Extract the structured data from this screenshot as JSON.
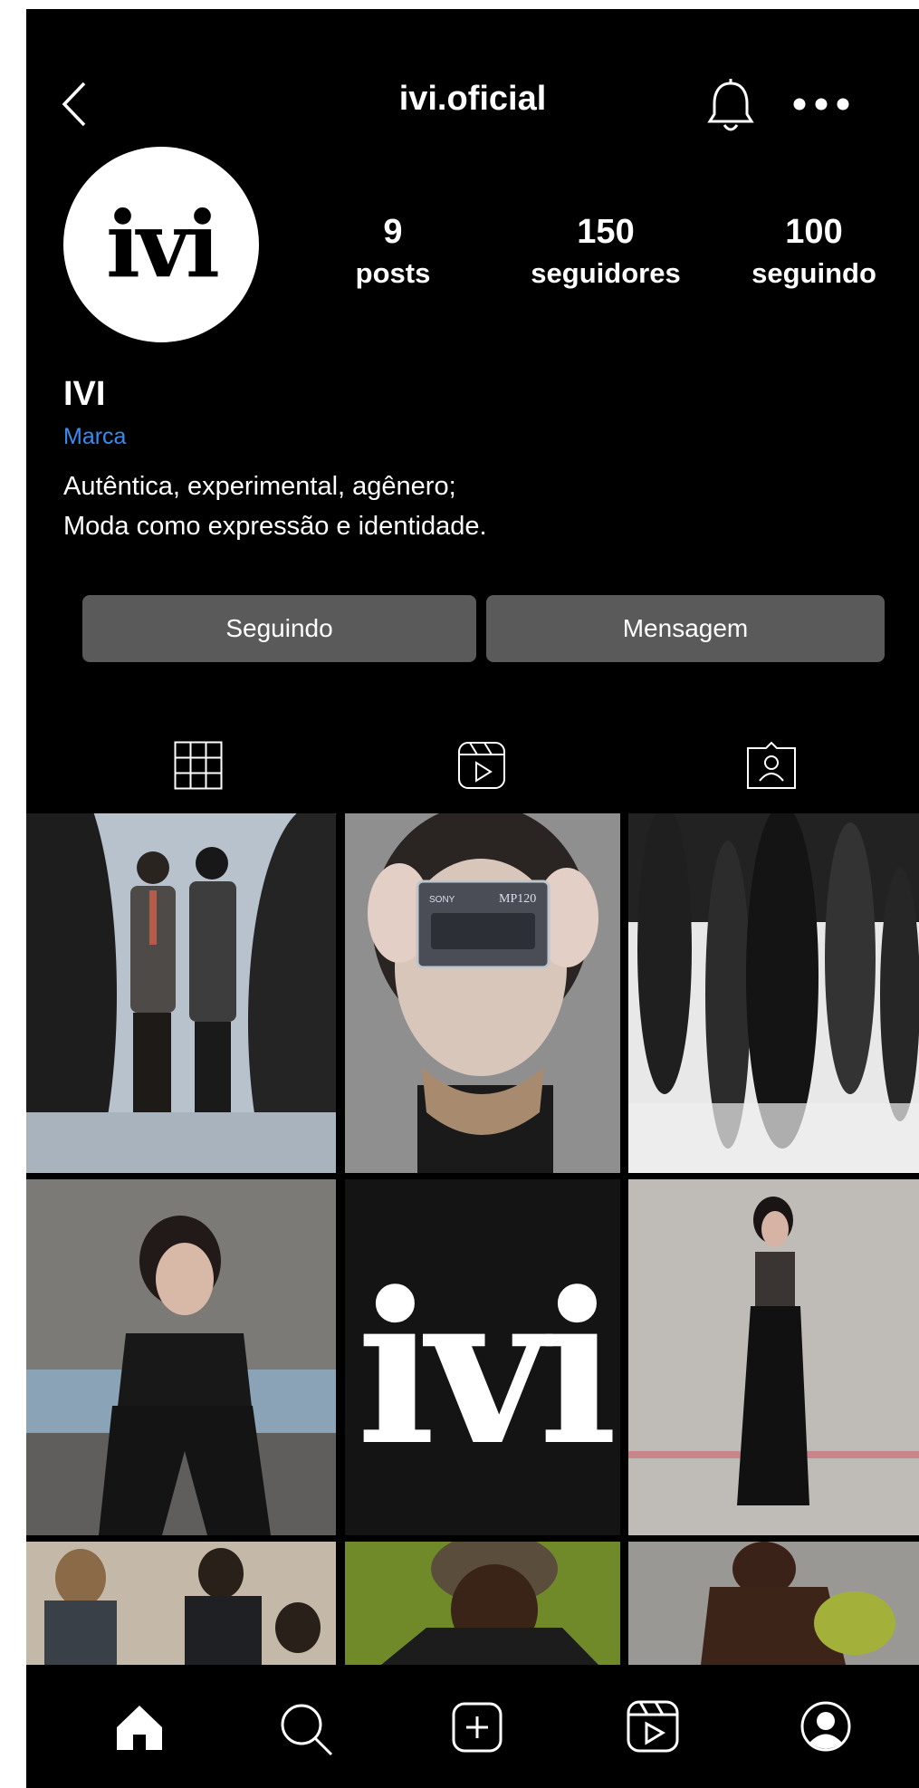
{
  "header": {
    "username": "ivi.oficial",
    "back_icon": "chevron-left-icon",
    "bell_icon": "bell-icon",
    "more_icon": "more-horizontal-icon"
  },
  "profile": {
    "avatar_text": "ivi",
    "name": "IVI",
    "category": "Marca",
    "bio_line1": "Autêntica, experimental, agênero;",
    "bio_line2": "Moda como expressão e identidade.",
    "stats": [
      {
        "value": "9",
        "label": "posts"
      },
      {
        "value": "150",
        "label": "seguidores"
      },
      {
        "value": "100",
        "label": "seguindo"
      }
    ],
    "accent_color": "#3a8bf0"
  },
  "actions": {
    "following_label": "Seguindo",
    "message_label": "Mensagem"
  },
  "tabs": [
    {
      "icon": "grid-icon"
    },
    {
      "icon": "reels-icon"
    },
    {
      "icon": "tagged-icon"
    }
  ],
  "grid": {
    "logo_text": "ivi",
    "cassette_brand": "SONY",
    "cassette_model": "MP120"
  },
  "bottom_nav": [
    {
      "icon": "home-icon"
    },
    {
      "icon": "search-icon"
    },
    {
      "icon": "add-post-icon"
    },
    {
      "icon": "reels-icon"
    },
    {
      "icon": "profile-icon"
    }
  ]
}
